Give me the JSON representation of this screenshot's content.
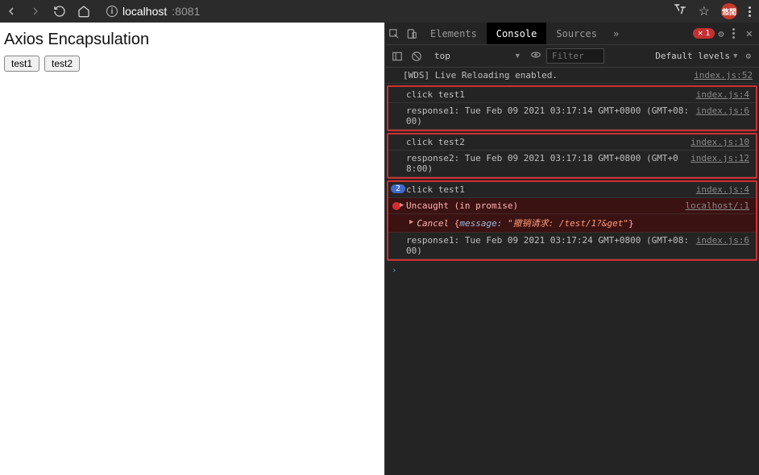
{
  "toolbar": {
    "url_host": "localhost",
    "url_port": ":8081",
    "avatar": "悠閒"
  },
  "page": {
    "title": "Axios Encapsulation",
    "buttons": [
      "test1",
      "test2"
    ]
  },
  "devtools": {
    "tabs": {
      "elements": "Elements",
      "console": "Console",
      "sources": "Sources"
    },
    "error_count": "1",
    "sub": {
      "context": "top",
      "filter_placeholder": "Filter",
      "levels": "Default levels"
    },
    "logs": [
      {
        "kind": "plain",
        "msg": "[WDS] Live Reloading enabled.",
        "src": "index.js:52"
      }
    ],
    "groups": [
      {
        "rows": [
          {
            "kind": "plain",
            "msg": "click test1",
            "src": "index.js:4"
          },
          {
            "kind": "plain",
            "msg": "response1: Tue Feb 09 2021 03:17:14 GMT+0800 (GMT+08:00)",
            "src": "index.js:6"
          }
        ]
      },
      {
        "rows": [
          {
            "kind": "plain",
            "msg": "click test2",
            "src": "index.js:10"
          },
          {
            "kind": "plain",
            "msg": "response2: Tue Feb 09 2021 03:17:18 GMT+0800 (GMT+08:00)",
            "src": "index.js:12"
          }
        ]
      },
      {
        "rows": [
          {
            "kind": "count",
            "count": "2",
            "msg": "click test1",
            "src": "index.js:4"
          },
          {
            "kind": "err",
            "msg": "Uncaught (in promise)",
            "src": "localhost/:1",
            "obj": {
              "ctor": "Cancel",
              "key": "message:",
              "val": "\"撤销请求: /test/1?&get\""
            }
          },
          {
            "kind": "plain",
            "msg": "response1: Tue Feb 09 2021 03:17:24 GMT+0800 (GMT+08:00)",
            "src": "index.js:6"
          }
        ]
      }
    ]
  }
}
